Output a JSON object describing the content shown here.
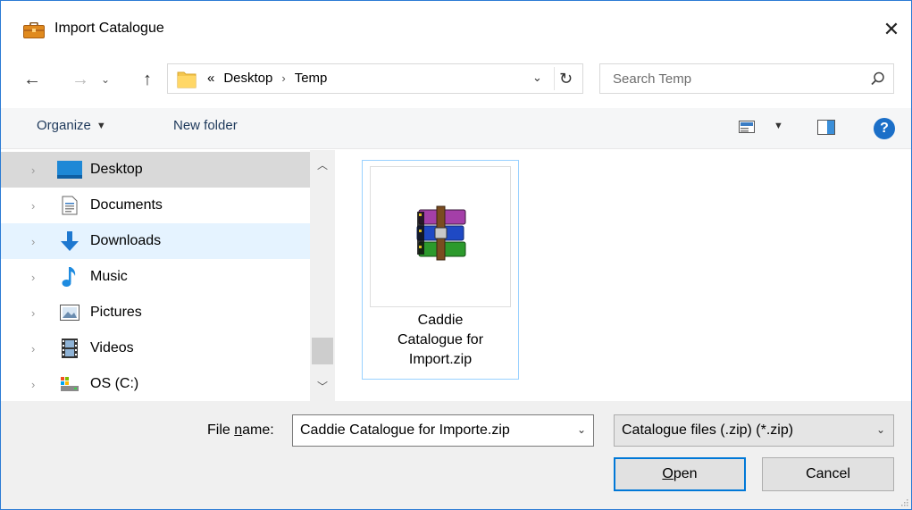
{
  "window": {
    "title": "Import Catalogue",
    "close_label": "✕"
  },
  "address": {
    "overflow_label": "«",
    "crumbs": [
      "Desktop",
      "Temp"
    ],
    "separator": "›"
  },
  "search": {
    "placeholder": "Search Temp"
  },
  "toolbar": {
    "organize_label": "Organize",
    "new_folder_label": "New folder",
    "help_label": "?"
  },
  "nav": {
    "items": [
      {
        "label": "Desktop",
        "icon": "desktop-icon",
        "state": "selected"
      },
      {
        "label": "Documents",
        "icon": "documents-icon",
        "state": "normal"
      },
      {
        "label": "Downloads",
        "icon": "downloads-icon",
        "state": "hover"
      },
      {
        "label": "Music",
        "icon": "music-icon",
        "state": "normal"
      },
      {
        "label": "Pictures",
        "icon": "pictures-icon",
        "state": "normal"
      },
      {
        "label": "Videos",
        "icon": "videos-icon",
        "state": "normal"
      },
      {
        "label": "OS (C:)",
        "icon": "drive-icon",
        "state": "normal"
      }
    ]
  },
  "files": [
    {
      "name_lines": [
        "Caddie",
        "Catalogue for",
        "Import.zip"
      ],
      "icon": "winrar-archive-icon"
    }
  ],
  "bottom": {
    "file_name_label_prefix": "File ",
    "file_name_label_underlined": "n",
    "file_name_label_suffix": "ame:",
    "file_name_value": "Caddie Catalogue for Importe.zip",
    "file_type_value": "Catalogue files (.zip)  (*.zip)",
    "open_underlined": "O",
    "open_rest": "pen",
    "cancel_label": "Cancel"
  },
  "colors": {
    "accent": "#0078d7",
    "selection": "#d9d9d9",
    "hover": "#e5f3ff",
    "tile_border": "#99d1ff"
  }
}
